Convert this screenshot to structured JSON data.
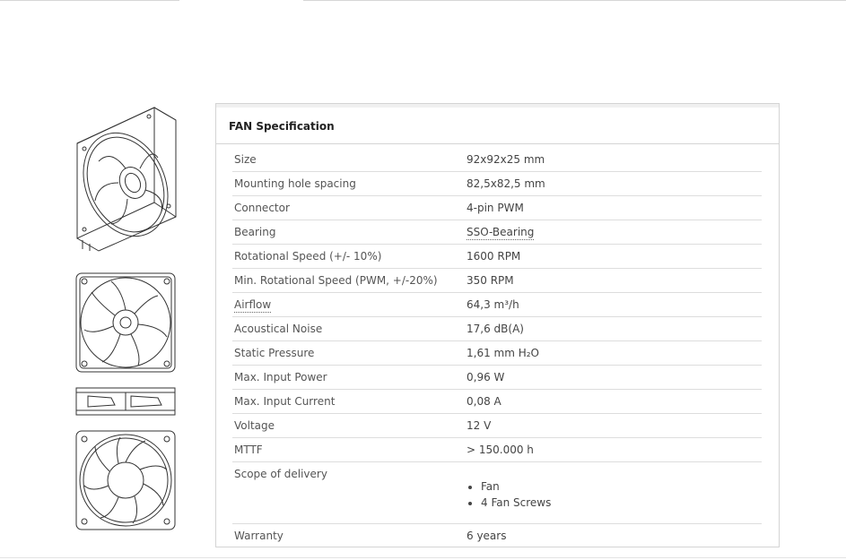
{
  "spec": {
    "title": "FAN Specification",
    "rows": [
      {
        "label": "Size",
        "value": "92x92x25 mm"
      },
      {
        "label": "Mounting hole spacing",
        "value": "82,5x82,5 mm"
      },
      {
        "label": "Connector",
        "value": "4-pin PWM"
      },
      {
        "label": "Bearing",
        "value": "SSO-Bearing"
      },
      {
        "label": "Rotational Speed (+/- 10%)",
        "value": "1600 RPM"
      },
      {
        "label": "Min. Rotational Speed (PWM, +/-20%)",
        "value": "350 RPM"
      },
      {
        "label": "Airflow",
        "value": "64,3 m³/h"
      },
      {
        "label": "Acoustical Noise",
        "value": "17,6 dB(A)"
      },
      {
        "label": "Static Pressure",
        "value": "1,61 mm H₂O"
      },
      {
        "label": "Max. Input Power",
        "value": "0,96 W"
      },
      {
        "label": "Max. Input Current",
        "value": "0,08 A"
      },
      {
        "label": "Voltage",
        "value": "12 V"
      },
      {
        "label": "MTTF",
        "value": "> 150.000 h"
      }
    ],
    "scope": {
      "label": "Scope of delivery",
      "items": [
        "Fan",
        "4 Fan Screws"
      ]
    },
    "warranty": {
      "label": "Warranty",
      "value": "6 years"
    }
  },
  "colors": {
    "border": "#d4d4d4",
    "text": "#444444",
    "title": "#222222"
  },
  "icons": [
    "fan-isometric-drawing",
    "fan-front-drawing",
    "fan-side-drawing",
    "fan-back-drawing"
  ]
}
